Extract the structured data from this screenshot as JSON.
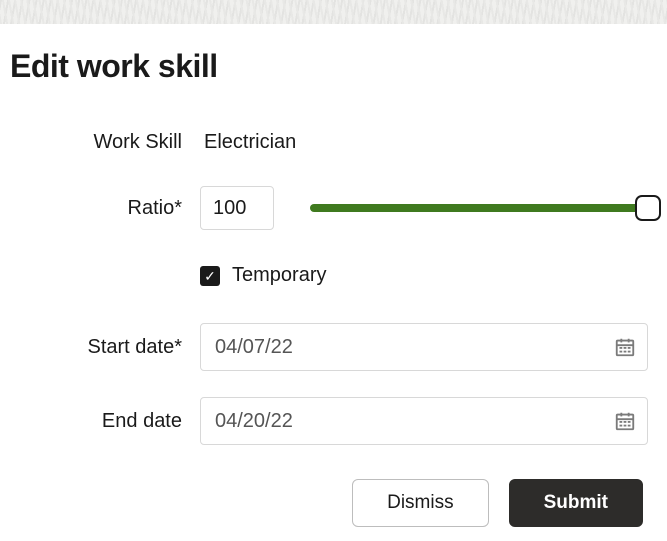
{
  "title": "Edit work skill",
  "fields": {
    "work_skill": {
      "label": "Work Skill",
      "value": "Electrician"
    },
    "ratio": {
      "label": "Ratio*",
      "value": "100",
      "slider_percent": 100
    },
    "temporary": {
      "label": "Temporary",
      "checked": true
    },
    "start_date": {
      "label": "Start date*",
      "value": "04/07/22"
    },
    "end_date": {
      "label": "End date",
      "value": "04/20/22"
    }
  },
  "actions": {
    "dismiss": "Dismiss",
    "submit": "Submit"
  }
}
